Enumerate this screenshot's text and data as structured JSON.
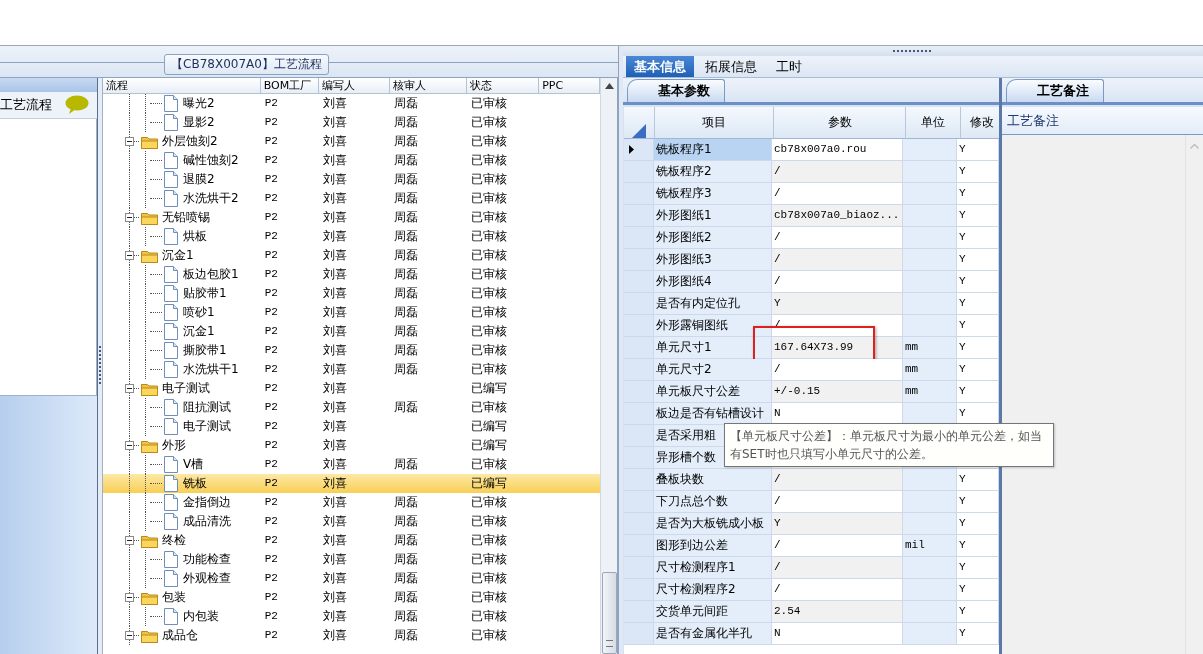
{
  "flow_tab": {
    "title": "【CB78X007A0】工艺流程"
  },
  "left_panel": {
    "title": "工艺流程"
  },
  "flow_table": {
    "columns": [
      "流程",
      "BOM工厂",
      "编写人",
      "核审人",
      "状态",
      "PPC"
    ],
    "rows": [
      {
        "children": [
          {
            "name": "曝光2",
            "factory": "P2",
            "author": "刘喜",
            "reviewer": "周磊",
            "status": "已审核",
            "selected": false
          },
          {
            "name": "显影2",
            "factory": "P2",
            "author": "刘喜",
            "reviewer": "周磊",
            "status": "已审核",
            "selected": false
          }
        ]
      },
      {
        "name": "外层蚀刻2",
        "expanded": true,
        "factory": "P2",
        "author": "刘喜",
        "reviewer": "周磊",
        "status": "已审核",
        "selected": false,
        "children": [
          {
            "name": "碱性蚀刻2",
            "factory": "P2",
            "author": "刘喜",
            "reviewer": "周磊",
            "status": "已审核",
            "selected": false
          },
          {
            "name": "退膜2",
            "factory": "P2",
            "author": "刘喜",
            "reviewer": "周磊",
            "status": "已审核",
            "selected": false
          },
          {
            "name": "水洗烘干2",
            "factory": "P2",
            "author": "刘喜",
            "reviewer": "周磊",
            "status": "已审核",
            "selected": false
          }
        ]
      },
      {
        "name": "无铅喷锡",
        "expanded": true,
        "factory": "P2",
        "author": "刘喜",
        "reviewer": "周磊",
        "status": "已审核",
        "selected": false,
        "children": [
          {
            "name": "烘板",
            "factory": "P2",
            "author": "刘喜",
            "reviewer": "周磊",
            "status": "已审核",
            "selected": false
          }
        ]
      },
      {
        "name": "沉金1",
        "expanded": true,
        "factory": "P2",
        "author": "刘喜",
        "reviewer": "周磊",
        "status": "已审核",
        "selected": false,
        "children": [
          {
            "name": "板边包胶1",
            "factory": "P2",
            "author": "刘喜",
            "reviewer": "周磊",
            "status": "已审核",
            "selected": false
          },
          {
            "name": "贴胶带1",
            "factory": "P2",
            "author": "刘喜",
            "reviewer": "周磊",
            "status": "已审核",
            "selected": false
          },
          {
            "name": "喷砂1",
            "factory": "P2",
            "author": "刘喜",
            "reviewer": "周磊",
            "status": "已审核",
            "selected": false
          },
          {
            "name": "沉金1",
            "factory": "P2",
            "author": "刘喜",
            "reviewer": "周磊",
            "status": "已审核",
            "selected": false
          },
          {
            "name": "撕胶带1",
            "factory": "P2",
            "author": "刘喜",
            "reviewer": "周磊",
            "status": "已审核",
            "selected": false
          },
          {
            "name": "水洗烘干1",
            "factory": "P2",
            "author": "刘喜",
            "reviewer": "周磊",
            "status": "已审核",
            "selected": false
          }
        ]
      },
      {
        "name": "电子测试",
        "expanded": true,
        "factory": "P2",
        "author": "刘喜",
        "status": "已编写",
        "selected": false,
        "children": [
          {
            "name": "阻抗测试",
            "factory": "P2",
            "author": "刘喜",
            "reviewer": "周磊",
            "status": "已审核",
            "selected": false
          },
          {
            "name": "电子测试",
            "factory": "P2",
            "author": "刘喜",
            "status": "已编写",
            "selected": false
          }
        ]
      },
      {
        "name": "外形",
        "expanded": true,
        "factory": "P2",
        "author": "刘喜",
        "status": "已编写",
        "selected": false,
        "children": [
          {
            "name": "V槽",
            "factory": "P2",
            "author": "刘喜",
            "reviewer": "周磊",
            "status": "已审核",
            "selected": false
          },
          {
            "name": "铣板",
            "factory": "P2",
            "author": "刘喜",
            "status": "已编写",
            "selected": true
          },
          {
            "name": "金指倒边",
            "factory": "P2",
            "author": "刘喜",
            "reviewer": "周磊",
            "status": "已审核",
            "selected": false
          },
          {
            "name": "成品清洗",
            "factory": "P2",
            "author": "刘喜",
            "reviewer": "周磊",
            "status": "已审核",
            "selected": false
          }
        ]
      },
      {
        "name": "终检",
        "expanded": true,
        "factory": "P2",
        "author": "刘喜",
        "reviewer": "周磊",
        "status": "已审核",
        "selected": false,
        "children": [
          {
            "name": "功能检查",
            "factory": "P2",
            "author": "刘喜",
            "reviewer": "周磊",
            "status": "已审核",
            "selected": false
          },
          {
            "name": "外观检查",
            "factory": "P2",
            "author": "刘喜",
            "reviewer": "周磊",
            "status": "已审核",
            "selected": false
          }
        ]
      },
      {
        "name": "包装",
        "expanded": true,
        "factory": "P2",
        "author": "刘喜",
        "reviewer": "周磊",
        "status": "已审核",
        "selected": false,
        "children": [
          {
            "name": "内包装",
            "factory": "P2",
            "author": "刘喜",
            "reviewer": "周磊",
            "status": "已审核",
            "selected": false
          }
        ]
      },
      {
        "name": "成品仓",
        "expanded": true,
        "factory": "P2",
        "author": "刘喜",
        "reviewer": "周磊",
        "status": "已审核",
        "selected": false
      }
    ]
  },
  "tabs": [
    {
      "label": "基本信息",
      "selected": true
    },
    {
      "label": "拓展信息",
      "selected": false
    },
    {
      "label": "工时",
      "selected": false
    }
  ],
  "params_panel": {
    "tab": "基本参数",
    "columns": [
      "项目",
      "参数",
      "单位",
      "修改"
    ],
    "rows": [
      {
        "item": "铣板程序1",
        "value": "cb78x007a0.rou",
        "modified": "Y",
        "current": true
      },
      {
        "item": "铣板程序2",
        "value": "/",
        "modified": "Y",
        "current": false
      },
      {
        "item": "铣板程序3",
        "value": "/",
        "modified": "Y",
        "current": false
      },
      {
        "item": "外形图纸1",
        "value": "cb78x007a0_biaoz...",
        "modified": "Y",
        "current": false
      },
      {
        "item": "外形图纸2",
        "value": "/",
        "modified": "Y",
        "current": false
      },
      {
        "item": "外形图纸3",
        "value": "/",
        "modified": "Y",
        "current": false
      },
      {
        "item": "外形图纸4",
        "value": "/",
        "modified": "Y",
        "current": false
      },
      {
        "item": "是否有内定位孔",
        "value": "Y",
        "modified": "Y",
        "current": false
      },
      {
        "item": "外形露铜图纸",
        "value": "/",
        "modified": "Y",
        "current": false
      },
      {
        "item": "单元尺寸1",
        "value": "167.64X73.99",
        "unit": "mm",
        "modified": "Y",
        "current": false,
        "highlighted": true
      },
      {
        "item": "单元尺寸2",
        "value": "/",
        "unit": "mm",
        "modified": "Y",
        "current": false
      },
      {
        "item": "单元板尺寸公差",
        "value": "+/-0.15",
        "unit": "mm",
        "modified": "Y",
        "current": false
      },
      {
        "item": "板边是否有钻槽设计",
        "value": "N",
        "modified": "Y",
        "current": false
      },
      {
        "item": "是否采用粗",
        "current": false
      },
      {
        "item": "异形槽个数",
        "current": false
      },
      {
        "item": "叠板块数",
        "value": "/",
        "modified": "Y",
        "current": false
      },
      {
        "item": "下刀点总个数",
        "value": "/",
        "modified": "Y",
        "current": false
      },
      {
        "item": "是否为大板铣成小板",
        "value": "Y",
        "modified": "Y",
        "current": false
      },
      {
        "item": "图形到边公差",
        "value": "/",
        "unit": "mil",
        "modified": "Y",
        "current": false
      },
      {
        "item": "尺寸检测程序1",
        "value": "/",
        "modified": "Y",
        "current": false
      },
      {
        "item": "尺寸检测程序2",
        "value": "/",
        "modified": "Y",
        "current": false
      },
      {
        "item": "交货单元间距",
        "value": "2.54",
        "modified": "Y",
        "current": false
      },
      {
        "item": "是否有金属化半孔",
        "value": "N",
        "modified": "Y",
        "current": false
      }
    ]
  },
  "tooltip": {
    "text": "【单元板尺寸公差】：单元板尺寸为最小的单元公差，如当有SET时也只填写小单元尺寸的公差。"
  },
  "remarks_panel": {
    "tab": "工艺备注",
    "header": "工艺备注"
  }
}
